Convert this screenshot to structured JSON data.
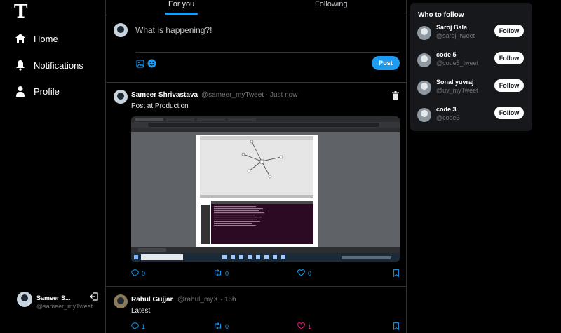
{
  "app": {
    "logo": "T"
  },
  "nav": {
    "items": [
      {
        "label": "Home",
        "icon": "home-icon"
      },
      {
        "label": "Notifications",
        "icon": "bell-icon"
      },
      {
        "label": "Profile",
        "icon": "person-icon"
      }
    ]
  },
  "account": {
    "name": "Sameer S...",
    "handle": "@sameer_myTweet"
  },
  "tabs": [
    {
      "label": "For you",
      "active": true
    },
    {
      "label": "Following",
      "active": false
    }
  ],
  "compose": {
    "placeholder": "What is happening?!",
    "post_label": "Post"
  },
  "tweets": [
    {
      "name": "Sameer Shrivastava",
      "handle": "@sameer_myTweet",
      "time": "· Just now",
      "text": "Post at Production",
      "replies": "0",
      "retweets": "0",
      "likes": "0"
    },
    {
      "name": "Rahul Gujjar",
      "handle": "@rahul_myX",
      "time": "· 16h",
      "text": "Latest",
      "replies": "1",
      "retweets": "0",
      "likes": "1"
    }
  ],
  "who_to_follow": {
    "title": "Who to follow",
    "follow_label": "Follow",
    "users": [
      {
        "name": "Saroj Bala",
        "handle": "@saroj_tweet"
      },
      {
        "name": "code 5",
        "handle": "@code5_tweet"
      },
      {
        "name": "Sonal yuvraj",
        "handle": "@uv_myTweet"
      },
      {
        "name": "code 3",
        "handle": "@code3"
      }
    ]
  },
  "colors": {
    "accent": "#1d9bf0",
    "background": "#000000",
    "card": "#16181c",
    "like": "#f91880"
  }
}
